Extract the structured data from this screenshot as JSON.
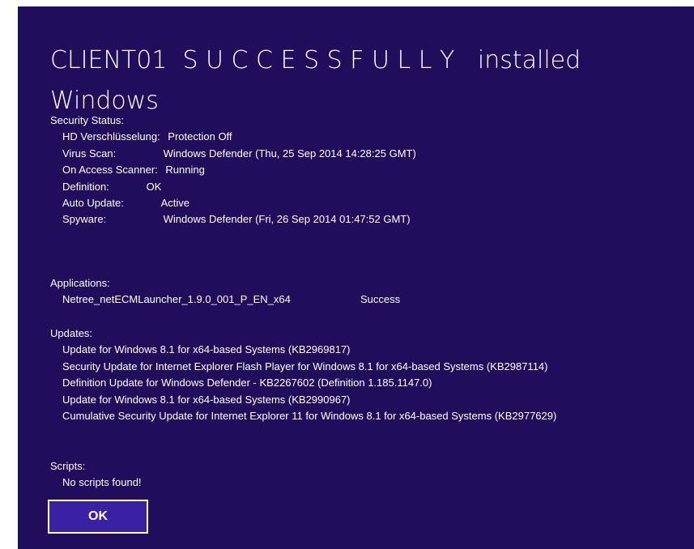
{
  "dialog": {
    "title": "CLIENT01  S U C C E S S F U L L Y   installed Windows",
    "ok_label": "OK",
    "colors": {
      "background": "#200e5c",
      "button": "#3a20a2",
      "text": "#ffffff"
    }
  },
  "security_status": {
    "heading": "Security Status:",
    "items": [
      {
        "label": "HD Verschlüsselung:",
        "value": "Protection Off"
      },
      {
        "label": "Virus Scan:",
        "value": "Windows Defender (Thu, 25 Sep 2014 14:28:25 GMT)"
      },
      {
        "label": "On Access Scanner:",
        "value": "Running"
      },
      {
        "label": "Definition:",
        "value": "OK"
      },
      {
        "label": "Auto Update:",
        "value": "Active"
      },
      {
        "label": "Spyware:",
        "value": "Windows Defender (Fri, 26 Sep 2014 01:47:52 GMT)"
      }
    ]
  },
  "applications": {
    "heading": "Applications:",
    "items": [
      {
        "name": "Netree_netECMLauncher_1.9.0_001_P_EN_x64",
        "status": "Success"
      }
    ]
  },
  "updates": {
    "heading": "Updates:",
    "items": [
      "Update for Windows 8.1 for x64-based Systems (KB2969817)",
      "Security Update for Internet Explorer Flash Player for Windows 8.1 for x64-based Systems (KB2987114)",
      "Definition Update for Windows Defender - KB2267602 (Definition 1.185.1147.0)",
      "Update for Windows 8.1 for x64-based Systems (KB2990967)",
      "Cumulative Security Update for Internet Explorer 11 for Windows 8.1 for x64-based Systems (KB2977629)"
    ]
  },
  "scripts": {
    "heading": "Scripts:",
    "message": "No scripts found!"
  }
}
